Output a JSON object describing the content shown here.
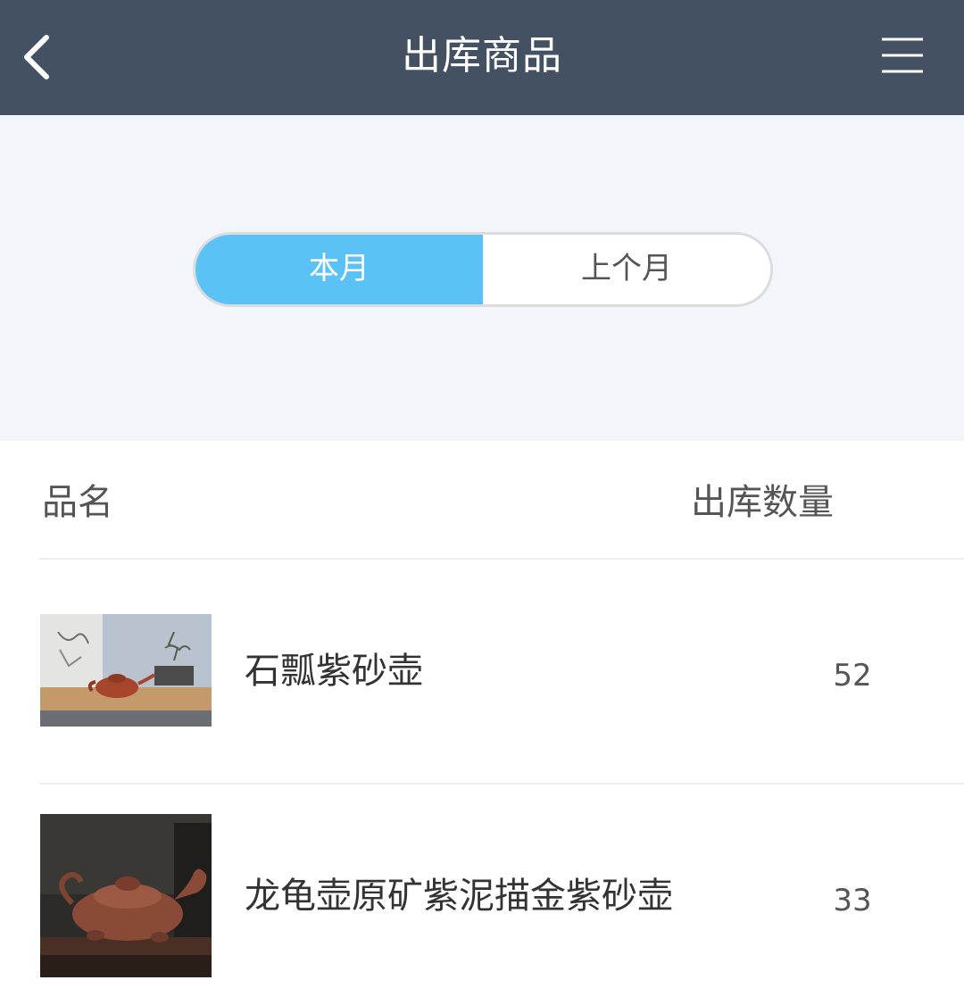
{
  "header": {
    "title": "出库商品",
    "back_icon": "chevron-left-icon",
    "menu_icon": "hamburger-menu-icon",
    "background_color": "#435163"
  },
  "filter": {
    "options": [
      "本月",
      "上个月"
    ],
    "selected": "本月",
    "active_color": "#5bc2f6"
  },
  "table": {
    "columns": [
      "品名",
      "出库数量"
    ],
    "rows": [
      {
        "name": "石瓢紫砂壶",
        "quantity": "52"
      },
      {
        "name": "龙龟壶原矿紫泥描金紫砂壶",
        "quantity": "33"
      }
    ]
  }
}
